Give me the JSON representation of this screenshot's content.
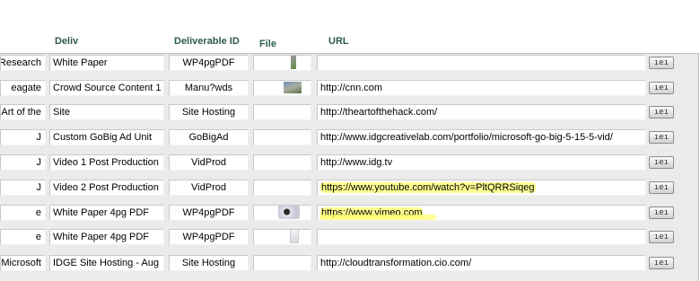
{
  "headers": {
    "deliv": "Deliv",
    "deliverable_id": "Deliverable ID",
    "file": "File",
    "url": "URL"
  },
  "button_label": "ıeı",
  "rows": [
    {
      "lead": "Research",
      "deliv": "White Paper",
      "id": "WP4pgPDF",
      "file_icon": "document-thumbnail",
      "url": ""
    },
    {
      "lead": "eagate",
      "deliv": "Crowd Source Content 1",
      "id": "Manu?wds",
      "file_icon": "photo-thumbnail",
      "url": "http://cnn.com"
    },
    {
      "lead": "Art of the",
      "deliv": "Site",
      "id": "Site Hosting",
      "file_icon": "",
      "url": "http://theartofthehack.com/"
    },
    {
      "lead": "J",
      "deliv": "Custom GoBig Ad Unit",
      "id": "GoBigAd",
      "file_icon": "",
      "url": "http://www.idgcreativelab.com/portfolio/microsoft-go-big-5-15-5-vid/"
    },
    {
      "lead": "J",
      "deliv": "Video 1 Post Production",
      "id": "VidProd",
      "file_icon": "",
      "url": "http://www.idg.tv"
    },
    {
      "lead": "J",
      "deliv": "Video 2 Post Production",
      "id": "VidProd",
      "file_icon": "",
      "url": "https://www.youtube.com/watch?v=PltQRRSiqeg"
    },
    {
      "lead": "e",
      "deliv": "White Paper 4pg PDF",
      "id": "WP4pgPDF",
      "file_icon": "media-thumbnail",
      "url": "https://www.vimeo.com"
    },
    {
      "lead": "e",
      "deliv": "White Paper 4pg PDF",
      "id": "WP4pgPDF",
      "file_icon": "document-thumbnail",
      "url": ""
    },
    {
      "lead": "Microsoft",
      "deliv": "IDGE Site Hosting - Aug",
      "id": "Site Hosting",
      "file_icon": "",
      "url": "http://cloudtransformation.cio.com/"
    }
  ]
}
